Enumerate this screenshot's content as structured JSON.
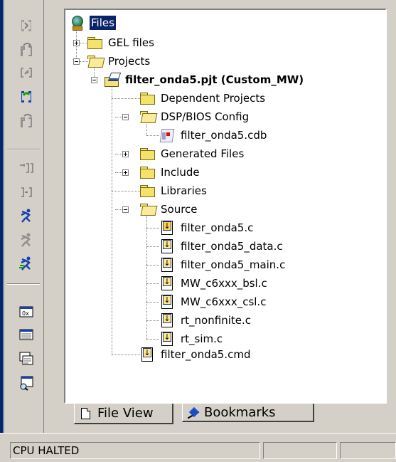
{
  "tree": {
    "root": {
      "label": "Files",
      "icon": "workspace-globe-icon"
    },
    "gel": {
      "label": "GEL files",
      "icon": "folder-icon"
    },
    "projects": {
      "label": "Projects",
      "icon": "folder-open-icon"
    },
    "project": {
      "label": "filter_onda5.pjt (Custom_MW)",
      "icon": "project-icon"
    },
    "dependent": {
      "label": "Dependent Projects"
    },
    "dspbios": {
      "label": "DSP/BIOS Config"
    },
    "cdb": {
      "label": "filter_onda5.cdb"
    },
    "generated": {
      "label": "Generated Files"
    },
    "include": {
      "label": "Include"
    },
    "libraries": {
      "label": "Libraries"
    },
    "source": {
      "label": "Source"
    },
    "sources": [
      {
        "label": "filter_onda5.c"
      },
      {
        "label": "filter_onda5_data.c"
      },
      {
        "label": "filter_onda5_main.c"
      },
      {
        "label": "MW_c6xxx_bsl.c"
      },
      {
        "label": "MW_c6xxx_csl.c"
      },
      {
        "label": "rt_nonfinite.c"
      },
      {
        "label": "rt_sim.c"
      }
    ],
    "cmd": {
      "label": "filter_onda5.cmd"
    }
  },
  "tabs": {
    "fileview": "File View",
    "bookmarks": "Bookmarks"
  },
  "status": {
    "text": "CPU HALTED"
  },
  "colors": {
    "selection": "#0a246a",
    "face": "#d4d0c8"
  }
}
